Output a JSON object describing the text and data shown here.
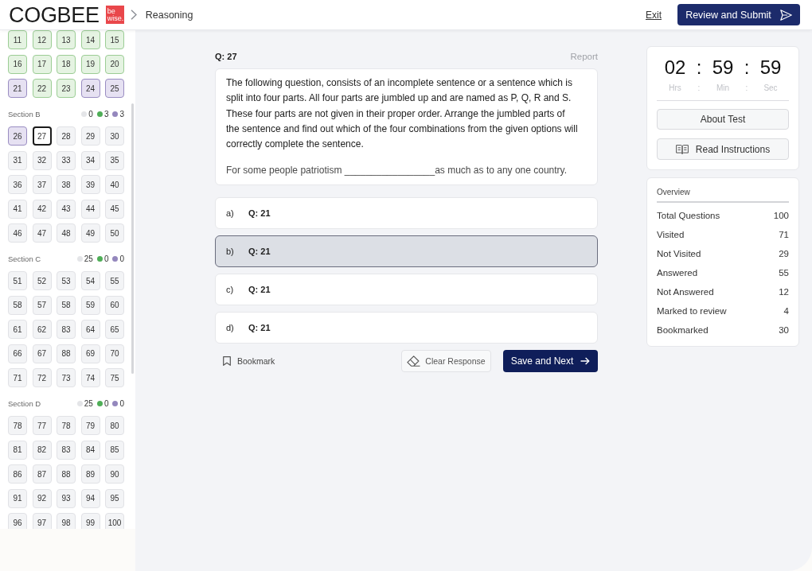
{
  "header": {
    "logo": {
      "wordmark": "COGBEE",
      "badge": [
        "be",
        "wise."
      ]
    },
    "breadcrumb": "Reasoning",
    "exit_link": "Exit",
    "submit_button": "Review and Submit"
  },
  "sidebar": {
    "sections": [
      {
        "cells": [
          {
            "label": "11",
            "answered": true,
            "marked": false,
            "selected": false
          },
          {
            "label": "12",
            "answered": true,
            "marked": false,
            "selected": false
          },
          {
            "label": "13",
            "answered": true,
            "marked": false,
            "selected": false
          },
          {
            "label": "14",
            "answered": true,
            "marked": false,
            "selected": false
          },
          {
            "label": "15",
            "answered": true,
            "marked": false,
            "selected": false
          },
          {
            "label": "16",
            "answered": true,
            "marked": false,
            "selected": false
          },
          {
            "label": "17",
            "answered": true,
            "marked": false,
            "selected": false
          },
          {
            "label": "18",
            "answered": true,
            "marked": false,
            "selected": false
          },
          {
            "label": "19",
            "answered": true,
            "marked": false,
            "selected": false
          },
          {
            "label": "20",
            "answered": true,
            "marked": false,
            "selected": false
          },
          {
            "label": "21",
            "answered": false,
            "marked": true,
            "selected": false
          },
          {
            "label": "22",
            "answered": true,
            "marked": false,
            "selected": false
          },
          {
            "label": "23",
            "answered": true,
            "marked": false,
            "selected": false
          },
          {
            "label": "24",
            "answered": false,
            "marked": true,
            "selected": false
          },
          {
            "label": "25",
            "answered": false,
            "marked": true,
            "selected": false
          }
        ]
      },
      {
        "title": "Section B",
        "legend": [
          {
            "count": "0",
            "color": "#e4e5e8"
          },
          {
            "count": "3",
            "color": "#4fae57"
          },
          {
            "count": "3",
            "color": "#9487bd"
          }
        ],
        "cells": [
          {
            "label": "26",
            "answered": false,
            "marked": true,
            "selected": false
          },
          {
            "label": "27",
            "answered": false,
            "marked": false,
            "selected": true
          },
          {
            "label": "28",
            "answered": false,
            "marked": false,
            "selected": false
          },
          {
            "label": "29",
            "answered": false,
            "marked": false,
            "selected": false
          },
          {
            "label": "30",
            "answered": false,
            "marked": false,
            "selected": false
          },
          {
            "label": "31",
            "answered": false,
            "marked": false,
            "selected": false
          },
          {
            "label": "32",
            "answered": false,
            "marked": false,
            "selected": false
          },
          {
            "label": "33",
            "answered": false,
            "marked": false,
            "selected": false
          },
          {
            "label": "34",
            "answered": false,
            "marked": false,
            "selected": false
          },
          {
            "label": "35",
            "answered": false,
            "marked": false,
            "selected": false
          },
          {
            "label": "36",
            "answered": false,
            "marked": false,
            "selected": false
          },
          {
            "label": "37",
            "answered": false,
            "marked": false,
            "selected": false
          },
          {
            "label": "38",
            "answered": false,
            "marked": false,
            "selected": false
          },
          {
            "label": "39",
            "answered": false,
            "marked": false,
            "selected": false
          },
          {
            "label": "40",
            "answered": false,
            "marked": false,
            "selected": false
          },
          {
            "label": "41",
            "answered": false,
            "marked": false,
            "selected": false
          },
          {
            "label": "42",
            "answered": false,
            "marked": false,
            "selected": false
          },
          {
            "label": "43",
            "answered": false,
            "marked": false,
            "selected": false
          },
          {
            "label": "44",
            "answered": false,
            "marked": false,
            "selected": false
          },
          {
            "label": "45",
            "answered": false,
            "marked": false,
            "selected": false
          },
          {
            "label": "46",
            "answered": false,
            "marked": false,
            "selected": false
          },
          {
            "label": "47",
            "answered": false,
            "marked": false,
            "selected": false
          },
          {
            "label": "48",
            "answered": false,
            "marked": false,
            "selected": false
          },
          {
            "label": "49",
            "answered": false,
            "marked": false,
            "selected": false
          },
          {
            "label": "50",
            "answered": false,
            "marked": false,
            "selected": false
          }
        ]
      },
      {
        "title": "Section C",
        "legend": [
          {
            "count": "25",
            "color": "#e4e5e8"
          },
          {
            "count": "0",
            "color": "#4fae57"
          },
          {
            "count": "0",
            "color": "#9487bd"
          }
        ],
        "cells": [
          {
            "label": "51",
            "answered": false,
            "marked": false,
            "selected": false
          },
          {
            "label": "52",
            "answered": false,
            "marked": false,
            "selected": false
          },
          {
            "label": "53",
            "answered": false,
            "marked": false,
            "selected": false
          },
          {
            "label": "54",
            "answered": false,
            "marked": false,
            "selected": false
          },
          {
            "label": "55",
            "answered": false,
            "marked": false,
            "selected": false
          },
          {
            "label": "58",
            "answered": false,
            "marked": false,
            "selected": false
          },
          {
            "label": "57",
            "answered": false,
            "marked": false,
            "selected": false
          },
          {
            "label": "58",
            "answered": false,
            "marked": false,
            "selected": false
          },
          {
            "label": "59",
            "answered": false,
            "marked": false,
            "selected": false
          },
          {
            "label": "60",
            "answered": false,
            "marked": false,
            "selected": false
          },
          {
            "label": "61",
            "answered": false,
            "marked": false,
            "selected": false
          },
          {
            "label": "62",
            "answered": false,
            "marked": false,
            "selected": false
          },
          {
            "label": "83",
            "answered": false,
            "marked": false,
            "selected": false
          },
          {
            "label": "64",
            "answered": false,
            "marked": false,
            "selected": false
          },
          {
            "label": "65",
            "answered": false,
            "marked": false,
            "selected": false
          },
          {
            "label": "66",
            "answered": false,
            "marked": false,
            "selected": false
          },
          {
            "label": "67",
            "answered": false,
            "marked": false,
            "selected": false
          },
          {
            "label": "88",
            "answered": false,
            "marked": false,
            "selected": false
          },
          {
            "label": "69",
            "answered": false,
            "marked": false,
            "selected": false
          },
          {
            "label": "70",
            "answered": false,
            "marked": false,
            "selected": false
          },
          {
            "label": "71",
            "answered": false,
            "marked": false,
            "selected": false
          },
          {
            "label": "72",
            "answered": false,
            "marked": false,
            "selected": false
          },
          {
            "label": "73",
            "answered": false,
            "marked": false,
            "selected": false
          },
          {
            "label": "74",
            "answered": false,
            "marked": false,
            "selected": false
          },
          {
            "label": "75",
            "answered": false,
            "marked": false,
            "selected": false
          }
        ]
      },
      {
        "title": "Section D",
        "legend": [
          {
            "count": "25",
            "color": "#e4e5e8"
          },
          {
            "count": "0",
            "color": "#4fae57"
          },
          {
            "count": "0",
            "color": "#9487bd"
          }
        ],
        "cells": [
          {
            "label": "78",
            "answered": false,
            "marked": false,
            "selected": false
          },
          {
            "label": "77",
            "answered": false,
            "marked": false,
            "selected": false
          },
          {
            "label": "78",
            "answered": false,
            "marked": false,
            "selected": false
          },
          {
            "label": "79",
            "answered": false,
            "marked": false,
            "selected": false
          },
          {
            "label": "80",
            "answered": false,
            "marked": false,
            "selected": false
          },
          {
            "label": "81",
            "answered": false,
            "marked": false,
            "selected": false
          },
          {
            "label": "82",
            "answered": false,
            "marked": false,
            "selected": false
          },
          {
            "label": "83",
            "answered": false,
            "marked": false,
            "selected": false
          },
          {
            "label": "84",
            "answered": false,
            "marked": false,
            "selected": false
          },
          {
            "label": "85",
            "answered": false,
            "marked": false,
            "selected": false
          },
          {
            "label": "86",
            "answered": false,
            "marked": false,
            "selected": false
          },
          {
            "label": "87",
            "answered": false,
            "marked": false,
            "selected": false
          },
          {
            "label": "88",
            "answered": false,
            "marked": false,
            "selected": false
          },
          {
            "label": "89",
            "answered": false,
            "marked": false,
            "selected": false
          },
          {
            "label": "90",
            "answered": false,
            "marked": false,
            "selected": false
          },
          {
            "label": "91",
            "answered": false,
            "marked": false,
            "selected": false
          },
          {
            "label": "92",
            "answered": false,
            "marked": false,
            "selected": false
          },
          {
            "label": "93",
            "answered": false,
            "marked": false,
            "selected": false
          },
          {
            "label": "94",
            "answered": false,
            "marked": false,
            "selected": false
          },
          {
            "label": "95",
            "answered": false,
            "marked": false,
            "selected": false
          },
          {
            "label": "96",
            "answered": false,
            "marked": false,
            "selected": false
          },
          {
            "label": "97",
            "answered": false,
            "marked": false,
            "selected": false
          },
          {
            "label": "98",
            "answered": false,
            "marked": false,
            "selected": false
          },
          {
            "label": "99",
            "answered": false,
            "marked": false,
            "selected": false
          },
          {
            "label": "100",
            "answered": false,
            "marked": false,
            "selected": false
          }
        ]
      }
    ]
  },
  "question": {
    "number": "Q: 27",
    "report_link": "Report",
    "text": "The following question, consists of an incomplete sentence or a sentence which is split into four parts. All four parts are jumbled up and are named as P, Q, R and S. These four parts are not given in their proper order. Arrange the jumbled parts of the sentence and find out which of the four combinations from the given options will correctly complete the sentence.",
    "sentence": "For some people patriotism _________________as much as to any one country.",
    "options": [
      {
        "letter": "a)",
        "text": "Q: 21",
        "selected": false
      },
      {
        "letter": "b)",
        "text": "Q: 21",
        "selected": true
      },
      {
        "letter": "c)",
        "text": "Q: 21",
        "selected": false
      },
      {
        "letter": "d)",
        "text": "Q: 21",
        "selected": false
      }
    ],
    "bookmark_button": "Bookmark",
    "clear_button": "Clear Response",
    "next_button": "Save and Next"
  },
  "timer": {
    "values": [
      "02",
      ":",
      "59",
      ":",
      "59"
    ],
    "units": [
      "Hrs",
      ":",
      "Min",
      ":",
      "Sec"
    ],
    "about_button": "About Test",
    "instructions_button": "Read Instructions"
  },
  "overview": {
    "title": "Overview",
    "rows": [
      {
        "label": "Total Questions",
        "value": "100"
      },
      {
        "label": "Visited",
        "value": "71"
      },
      {
        "label": "Not Visited",
        "value": "29"
      },
      {
        "label": "Answered",
        "value": "55"
      },
      {
        "label": "Not Answered",
        "value": "12"
      },
      {
        "label": "Marked to review",
        "value": "4"
      },
      {
        "label": "Bookmarked",
        "value": "30"
      }
    ]
  }
}
